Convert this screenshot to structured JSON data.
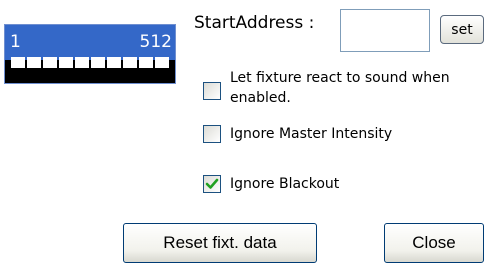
{
  "dmx_strip": {
    "start_channel": "1",
    "end_channel": "512",
    "accent_color": "#3468c8"
  },
  "start_address": {
    "label": "StartAddress :",
    "value": "",
    "set_label": "set"
  },
  "options": {
    "react_to_sound": {
      "label": "Let fixture react to sound when enabled.",
      "checked": false
    },
    "ignore_master_intensity": {
      "label": "Ignore Master Intensity",
      "checked": false
    },
    "ignore_blackout": {
      "label": "Ignore Blackout",
      "checked": true
    }
  },
  "buttons": {
    "reset_label": "Reset fixt. data",
    "close_label": "Close"
  }
}
